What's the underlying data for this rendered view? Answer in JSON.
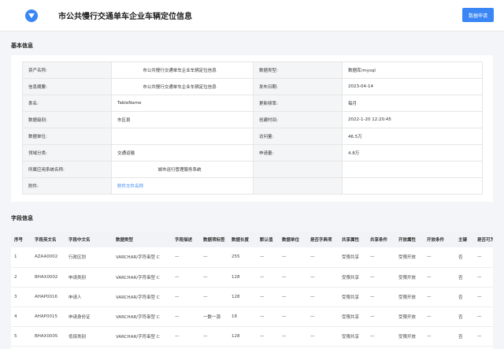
{
  "header": {
    "title": "市公共慢行交通单车企业车辆定位信息",
    "button_label": "数据申请"
  },
  "basic_info": {
    "section_title": "基本信息",
    "rows": [
      {
        "k1": "资产名称:",
        "v1": "市公共慢行交通单车企业车辆定位信息",
        "k2": "数据类型:",
        "v2": "数据库/mysql"
      },
      {
        "k1": "信息摘要:",
        "v1": "市公共慢行交通单车企业车辆定位信息",
        "k2": "发布日期:",
        "v2": "2023-04-14"
      },
      {
        "k1": "表名:",
        "v1": "TableName",
        "k2": "更新频率:",
        "v2": "每月"
      },
      {
        "k1": "数据级别:",
        "v1": "市区县",
        "k2": "创建时间:",
        "v2": "2022-1-20 12:20:45"
      },
      {
        "k1": "数据单位:",
        "v1": "",
        "k2": "访问量:",
        "v2": "46.5万"
      },
      {
        "k1": "领域分类:",
        "v1": "交通运输",
        "k2": "申请量:",
        "v2": "4.8万"
      },
      {
        "k1": "所属应用系统名称:",
        "v1": "城市运行管理服务系统",
        "k2": "",
        "v2": ""
      },
      {
        "k1": "附件:",
        "v1": "附件文件名称",
        "k2": "",
        "v2": ""
      }
    ]
  },
  "field_info": {
    "section_title": "字段信息",
    "columns": [
      "序号",
      "字段英文名",
      "字段中文名",
      "数据类型",
      "字段描述",
      "数据项标签",
      "数据长度",
      "默认值",
      "数据单位",
      "是否字典项",
      "共享属性",
      "共享条件",
      "开放属性",
      "开放条件",
      "主键",
      "是否可为空"
    ],
    "rows": [
      [
        "1",
        "AZAA0002",
        "行政区划",
        "VARCHAR/字符串型 C",
        "—",
        "—",
        "255",
        "—",
        "—",
        "—",
        "受限共享",
        "—",
        "受限开放",
        "—",
        "否",
        "—"
      ],
      [
        "2",
        "BHAX0002",
        "申请类别",
        "VARCHAR/字符串型 C",
        "—",
        "—",
        "128",
        "—",
        "—",
        "—",
        "受限共享",
        "—",
        "受限开放",
        "—",
        "否",
        "—"
      ],
      [
        "3",
        "AHAP0016",
        "申请人",
        "VARCHAR/字符串型 C",
        "—",
        "—",
        "128",
        "—",
        "—",
        "—",
        "受限共享",
        "—",
        "受限开放",
        "—",
        "否",
        "—"
      ],
      [
        "4",
        "AHAP0015",
        "申请身份证",
        "VARCHAR/字符串型 C",
        "—",
        "一数一源",
        "18",
        "—",
        "—",
        "—",
        "受限共享",
        "—",
        "受限开放",
        "—",
        "否",
        "—"
      ],
      [
        "5",
        "BHAX0005",
        "低保类别",
        "VARCHAR/字符串型 C",
        "—",
        "—",
        "128",
        "—",
        "—",
        "—",
        "受限共享",
        "—",
        "受限开放",
        "—",
        "否",
        "—"
      ]
    ]
  }
}
